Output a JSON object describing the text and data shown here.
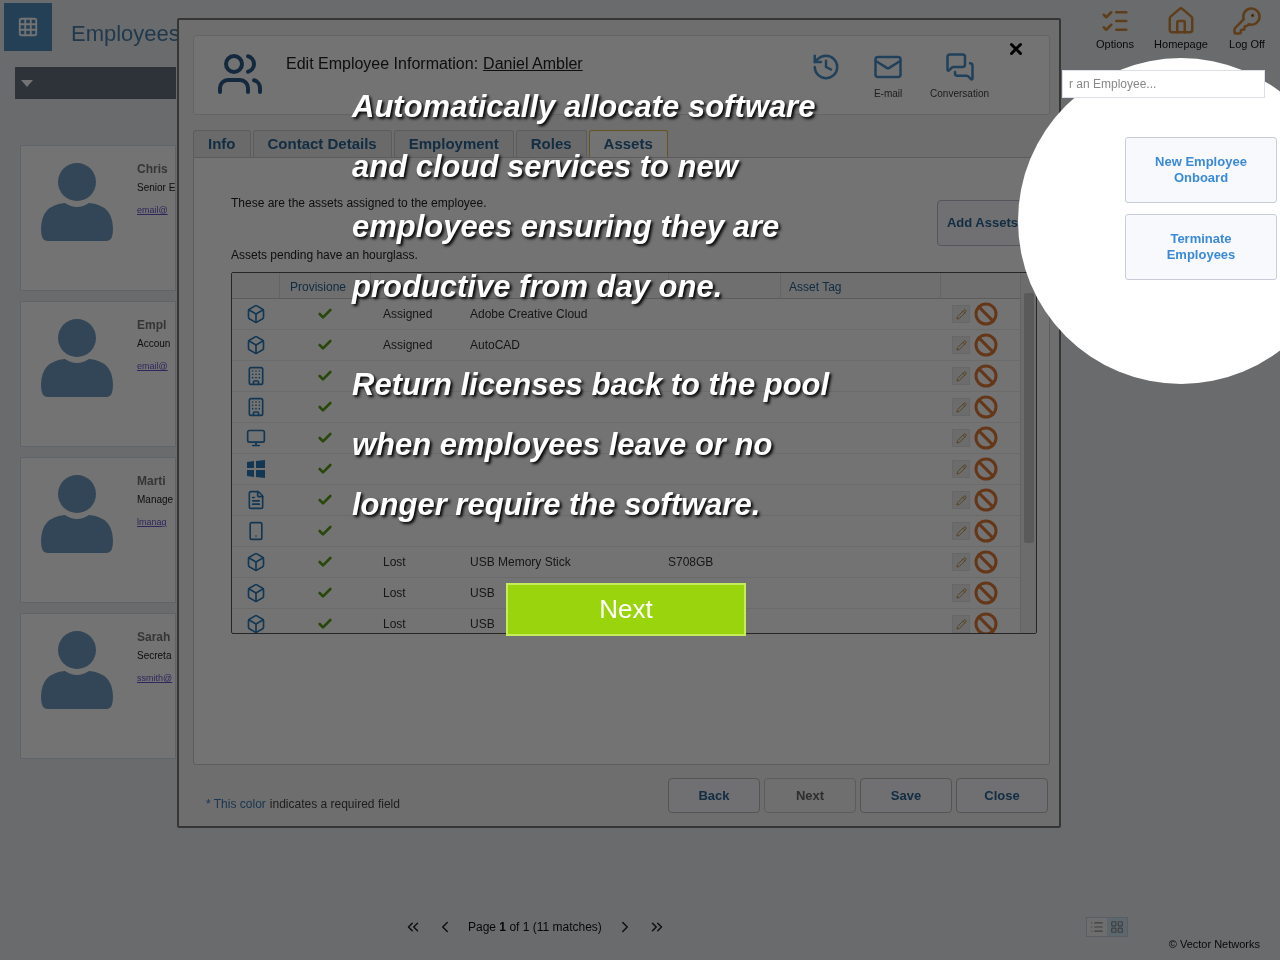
{
  "app": {
    "title": "Employees",
    "toolbar": [
      {
        "kind": "options",
        "label": "Options"
      },
      {
        "kind": "home",
        "label": "Homepage"
      },
      {
        "kind": "key",
        "label": "Log Off"
      }
    ],
    "search": {
      "placeholder": "r an Employee..."
    },
    "actions": [
      "New Employee Onboard",
      "Terminate Employees"
    ]
  },
  "employees": [
    {
      "name": "Chris",
      "role": "Senior E",
      "email": "email@"
    },
    {
      "name": "Empl",
      "role": "Accoun",
      "email": "email@"
    },
    {
      "name": "Marti",
      "role": "Manage",
      "email": "lmanag"
    },
    {
      "name": "Sarah",
      "role": "Secreta",
      "email": "ssmith@"
    }
  ],
  "pager": {
    "text": "Page **1** of 1 (11 matches)"
  },
  "view_toggle": [
    {
      "kind": "list",
      "selected": false
    },
    {
      "kind": "grid",
      "selected": true
    }
  ],
  "copyright": "© Vector Networks",
  "dialog": {
    "title": "Edit Employee Information:",
    "employee": "Daniel Ambler",
    "tools": [
      {
        "kind": "history"
      },
      {
        "kind": "email",
        "label": "E-mail"
      },
      {
        "kind": "conversation",
        "label": "Conversation"
      }
    ],
    "tabs": [
      {
        "label": "Info",
        "selected": false
      },
      {
        "label": "Contact Details",
        "selected": false
      },
      {
        "label": "Employment",
        "selected": false
      },
      {
        "label": "Roles",
        "selected": false
      },
      {
        "label": "Assets",
        "selected": true
      }
    ],
    "intro": "These are the assets assigned to the employee.",
    "pending_note": "Assets pending have an hourglass.",
    "add_button": "Add Assets",
    "columns": {
      "provisioned": "Provisione",
      "asset_tag": "Asset Tag"
    },
    "rows": [
      {
        "kind": "box",
        "provisioned": true,
        "status": "Assigned",
        "name": "Adobe Creative Cloud"
      },
      {
        "kind": "box",
        "provisioned": true,
        "status": "Assigned",
        "name": "AutoCAD"
      },
      {
        "kind": "building",
        "provisioned": true
      },
      {
        "kind": "building",
        "provisioned": true
      },
      {
        "kind": "monitor",
        "provisioned": true
      },
      {
        "kind": "windows",
        "provisioned": true
      },
      {
        "kind": "document",
        "provisioned": true
      },
      {
        "kind": "phone",
        "provisioned": true
      },
      {
        "kind": "box",
        "provisioned": true,
        "status": "Lost",
        "name": "USB Memory Stick",
        "serial": "S708GB"
      },
      {
        "kind": "box",
        "provisioned": true,
        "status": "Lost",
        "name": "USB"
      },
      {
        "kind": "box",
        "provisioned": true,
        "status": "Lost",
        "name": "USB"
      }
    ],
    "required_mark": "* This color",
    "required_note": "indicates a required field",
    "buttons": [
      {
        "label": "Back",
        "disabled": false
      },
      {
        "label": "Next",
        "disabled": true
      },
      {
        "label": "Save",
        "disabled": false
      },
      {
        "label": "Close",
        "disabled": false
      }
    ]
  },
  "tutorial": {
    "paragraphs": [
      {
        "lines": [
          "Automatically allocate software",
          "and cloud services to new",
          "employees ensuring they are",
          "productive from day one."
        ]
      },
      {
        "lines": [
          "Return licenses back to the pool",
          "when employees leave or no",
          "longer require the software."
        ]
      }
    ],
    "next": "Next"
  }
}
